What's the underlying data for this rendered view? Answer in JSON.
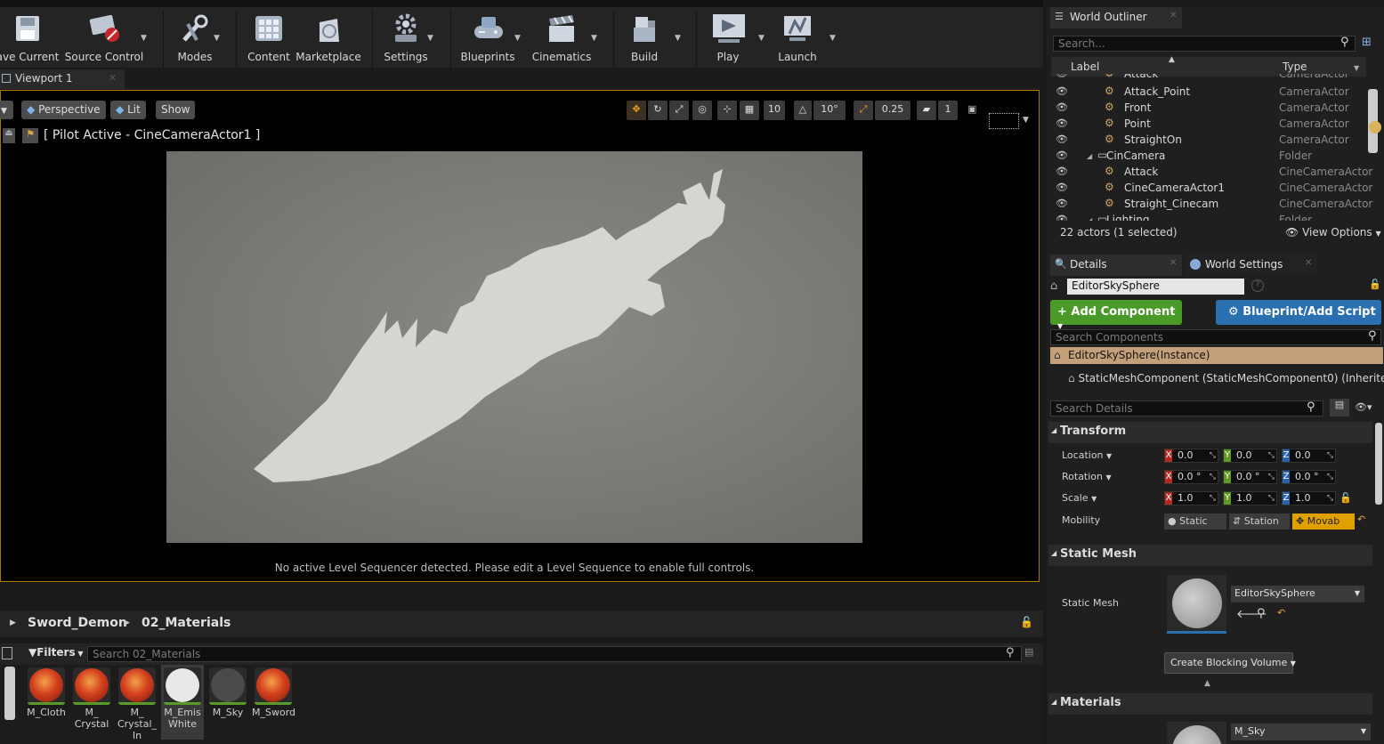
{
  "toolbar": {
    "save": "ave Current",
    "source_control": "Source Control",
    "modes": "Modes",
    "content": "Content",
    "marketplace": "Marketplace",
    "settings": "Settings",
    "blueprints": "Blueprints",
    "cinematics": "Cinematics",
    "build": "Build",
    "play": "Play",
    "launch": "Launch"
  },
  "viewport": {
    "tab_label": "Viewport 1",
    "perspective": "Perspective",
    "lit": "Lit",
    "show": "Show",
    "pilot_text": "[ Pilot Active - CineCameraActor1 ]",
    "grid_snap": "10",
    "rotation_snap": "10°",
    "scale_snap": "0.25",
    "camera_speed": "1",
    "message": "No active Level Sequencer detected. Please edit a Level Sequence to enable full controls."
  },
  "content_browser": {
    "breadcrumb": [
      "Sword_Demon",
      "02_Materials"
    ],
    "filters_label": "Filters",
    "search_placeholder": "Search 02_Materials",
    "assets": [
      {
        "name": "M_Cloth",
        "kind": "lava"
      },
      {
        "name": "M_\nCrystal",
        "kind": "lava"
      },
      {
        "name": "M_\nCrystal_\nIn",
        "kind": "lava"
      },
      {
        "name": "M_Emis\nWhite",
        "kind": "white"
      },
      {
        "name": "M_Sky",
        "kind": "dark"
      },
      {
        "name": "M_Sword",
        "kind": "lava"
      }
    ]
  },
  "outliner": {
    "tab_label": "World Outliner",
    "search_placeholder": "Search...",
    "col_label": "Label",
    "col_type": "Type",
    "rows": [
      {
        "label": "Attack",
        "type": "CameraActor",
        "indent": 2,
        "icon": "camera"
      },
      {
        "label": "Attack_Point",
        "type": "CameraActor",
        "indent": 2,
        "icon": "camera"
      },
      {
        "label": "Front",
        "type": "CameraActor",
        "indent": 2,
        "icon": "camera"
      },
      {
        "label": "Point",
        "type": "CameraActor",
        "indent": 2,
        "icon": "camera"
      },
      {
        "label": "StraightOn",
        "type": "CameraActor",
        "indent": 2,
        "icon": "camera"
      },
      {
        "label": "CinCamera",
        "type": "Folder",
        "indent": 1,
        "icon": "folder"
      },
      {
        "label": "Attack",
        "type": "CineCameraActor",
        "indent": 2,
        "icon": "camera"
      },
      {
        "label": "CineCameraActor1",
        "type": "CineCameraActor",
        "indent": 2,
        "icon": "camera"
      },
      {
        "label": "Straight_Cinecam",
        "type": "CineCameraActor",
        "indent": 2,
        "icon": "camera"
      },
      {
        "label": "Lighting",
        "type": "Folder",
        "indent": 1,
        "icon": "folder"
      }
    ],
    "status": "22 actors (1 selected)",
    "view_options": "View Options"
  },
  "details": {
    "tab_label": "Details",
    "world_settings_tab": "World Settings",
    "actor_name": "EditorSkySphere",
    "add_component": "+ Add Component",
    "blueprint_script": "Blueprint/Add Script",
    "search_components": "Search Components",
    "instance_label": "EditorSkySphere(Instance)",
    "component_label": "StaticMeshComponent (StaticMeshComponent0) (Inherited)",
    "search_details": "Search Details",
    "transform": {
      "title": "Transform",
      "location_label": "Location",
      "rotation_label": "Rotation",
      "scale_label": "Scale",
      "location": [
        "0.0",
        "0.0",
        "0.0"
      ],
      "rotation": [
        "0.0 °",
        "0.0 °",
        "0.0 °"
      ],
      "scale": [
        "1.0",
        "1.0",
        "1.0"
      ],
      "mobility_label": "Mobility",
      "mobility_options": [
        "Static",
        "Station",
        "Movab"
      ],
      "mobility_selected": "Movab"
    },
    "static_mesh": {
      "title": "Static Mesh",
      "label": "Static Mesh",
      "value": "EditorSkySphere",
      "create_blocking": "Create Blocking Volume"
    },
    "materials": {
      "title": "Materials",
      "value": "M_Sky"
    }
  },
  "colors": {
    "accent_orange": "#b27400",
    "add_component_green": "#4a9a2a",
    "blueprint_blue": "#2a6fb0",
    "instance_bg": "#c4a07a",
    "x_axis": "#b72a1f",
    "y_axis": "#5d9a1d",
    "z_axis": "#2862b0",
    "movable_selected": "#e0a000"
  }
}
